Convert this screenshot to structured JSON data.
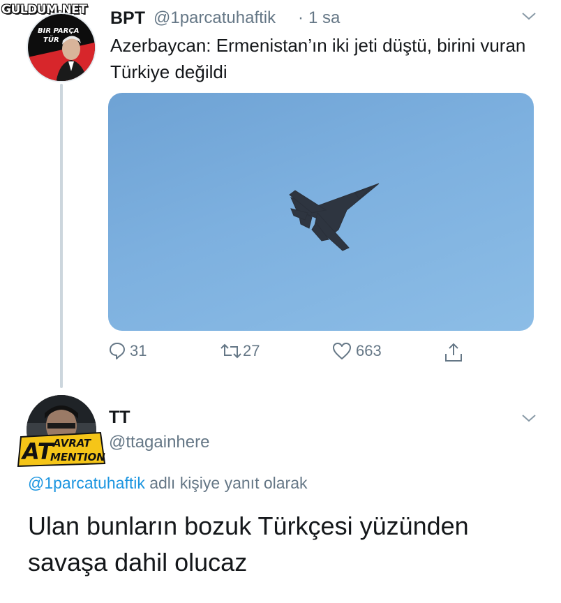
{
  "watermark": "GULDUM.NET",
  "tweet": {
    "avatar_text": "BIR PARÇA TÜRK",
    "name": "BPT",
    "handle": "@1parcatuhaftik",
    "separator": "·",
    "time": "1 sa",
    "text": "Azerbaycan: Ermenistan’ın iki jeti düştü, birini vuran Türkiye değildi",
    "media_icon": "fighter-jet-in-sky",
    "stats": {
      "replies": "31",
      "retweets": "27",
      "likes": "663"
    }
  },
  "reply": {
    "name": "TT",
    "handle": "@ttagainhere",
    "badge": {
      "big": "AT",
      "line1": "AVRAT",
      "line2": "MENTION"
    },
    "replying_to_mention": "@1parcatuhaftik",
    "replying_to_suffix": " adlı kişiye yanıt olarak",
    "text": "Ulan bunların bozuk Türkçesi yüzünden savaşa dahil olucaz"
  },
  "colors": {
    "muted": "#657786",
    "link": "#1b95e0",
    "sky": "#7db0df",
    "badge_yellow": "#f5c518",
    "avatar_red": "#d7262b"
  }
}
